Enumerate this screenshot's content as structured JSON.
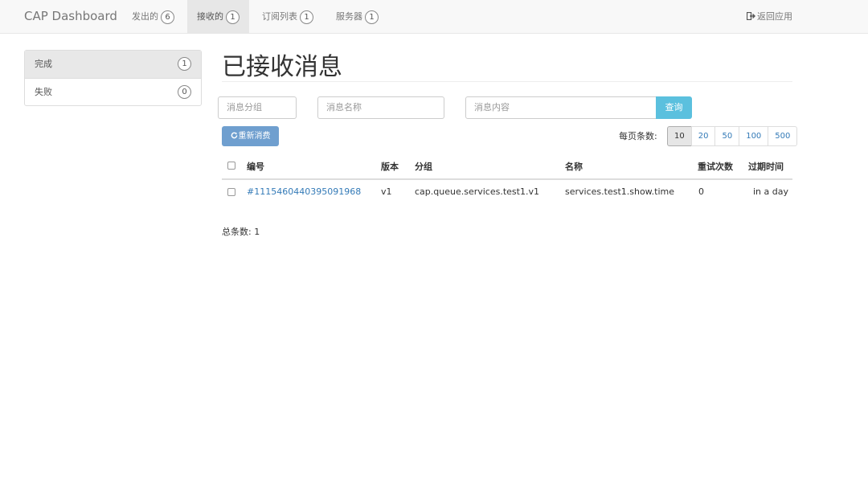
{
  "navbar": {
    "brand": "CAP Dashboard",
    "items": [
      {
        "label": "发出的",
        "count": "6"
      },
      {
        "label": "接收的",
        "count": "1"
      },
      {
        "label": "订阅列表",
        "count": "1"
      },
      {
        "label": "服务器",
        "count": "1"
      }
    ],
    "back_label": "返回应用"
  },
  "sidebar": {
    "items": [
      {
        "label": "完成",
        "count": "1"
      },
      {
        "label": "失败",
        "count": "0"
      }
    ]
  },
  "main": {
    "title": "已接收消息",
    "filters": {
      "group_placeholder": "消息分组",
      "name_placeholder": "消息名称",
      "content_placeholder": "消息内容",
      "query_label": "查询"
    },
    "requeue_label": "重新消费",
    "page_size_label": "每页条数:",
    "page_sizes": [
      "10",
      "20",
      "50",
      "100",
      "500"
    ],
    "table": {
      "headers": [
        "编号",
        "版本",
        "分组",
        "名称",
        "重试次数",
        "过期时间"
      ],
      "rows": [
        {
          "id": "#1115460440395091968",
          "version": "v1",
          "group": "cap.queue.services.test1.v1",
          "name": "services.test1.show.time",
          "retries": "0",
          "expires": "in a day"
        }
      ]
    },
    "total_label": "总条数: 1"
  }
}
